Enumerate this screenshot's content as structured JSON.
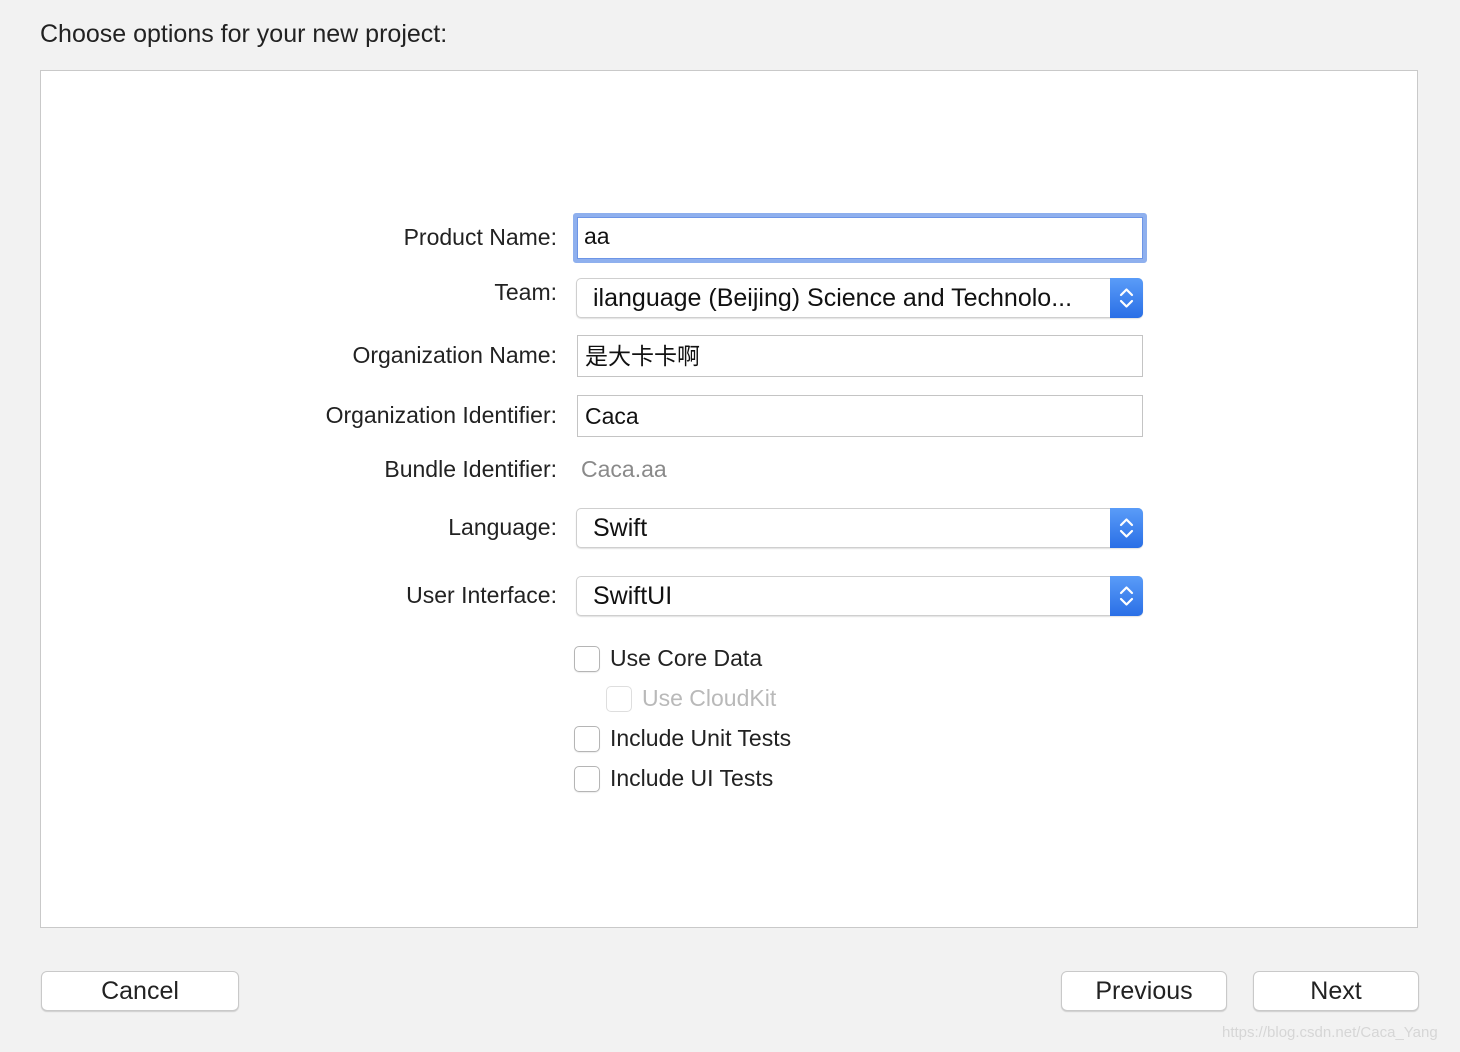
{
  "heading": "Choose options for your new project:",
  "form": {
    "product_name_label": "Product Name:",
    "product_name_value": "aa",
    "team_label": "Team:",
    "team_value": "ilanguage (Beijing) Science and Technolo...",
    "org_name_label": "Organization Name:",
    "org_name_value": "是大卡卡啊",
    "org_id_label": "Organization Identifier:",
    "org_id_value": "Caca",
    "bundle_id_label": "Bundle Identifier:",
    "bundle_id_value": "Caca.aa",
    "language_label": "Language:",
    "language_value": "Swift",
    "ui_label": "User Interface:",
    "ui_value": "SwiftUI"
  },
  "options": {
    "core_data": "Use Core Data",
    "cloudkit": "Use CloudKit",
    "unit_tests": "Include Unit Tests",
    "ui_tests": "Include UI Tests"
  },
  "buttons": {
    "cancel": "Cancel",
    "previous": "Previous",
    "next": "Next"
  },
  "watermark": "https://blog.csdn.net/Caca_Yang",
  "colors": {
    "accent": "#3b82f6",
    "focus_ring": "#8fb0ee",
    "background": "#f2f2f2"
  }
}
